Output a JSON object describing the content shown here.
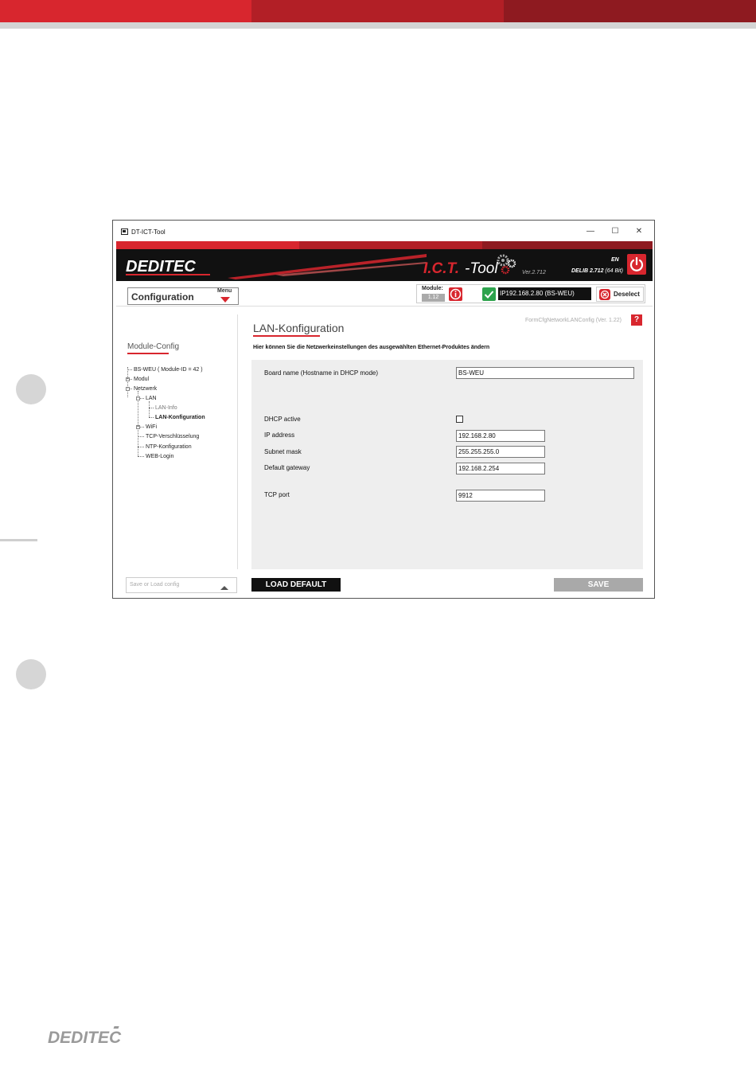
{
  "colors": {
    "accent_red": "#d8262e",
    "dark_red": "#9e1b22",
    "banner_black": "#111111",
    "panel_gray": "#eeeeee",
    "ok_green": "#2da34d"
  },
  "window": {
    "title": "DT-ICT-Tool",
    "minimize": "—",
    "maximize": "☐",
    "close": "✕"
  },
  "banner": {
    "logo_text": "DEDITEC",
    "app_name_ict": "I.C.T.",
    "app_name_tool": "-Tool",
    "version": "Ver.2.712",
    "language": "EN",
    "delib_label": "DELIB 2.712",
    "delib_bits": "(64 Bit)",
    "power_icon": "power-icon",
    "gears_icon": "gears-icon"
  },
  "toolbar": {
    "configuration_label": "Configuration",
    "menu_label": "Menu",
    "module_label": "Module:",
    "module_value": "1.12",
    "ip_value": "IP192.168.2.80 (BS-WEU)",
    "deselect_label": "Deselect"
  },
  "sidebar": {
    "title": "Module-Config",
    "tree": [
      {
        "label": "BS-WEU ( Module-ID = 42 )"
      },
      {
        "label": "Modul"
      },
      {
        "label": "Netzwerk"
      },
      {
        "label": "LAN"
      },
      {
        "label": "LAN-Info"
      },
      {
        "label": "LAN-Konfiguration"
      },
      {
        "label": "WiFi"
      },
      {
        "label": "TCP-Verschlüsselung"
      },
      {
        "label": "NTP-Konfiguration"
      },
      {
        "label": "WEB-Login"
      }
    ],
    "save_load_placeholder": "Save or Load config"
  },
  "main": {
    "title": "LAN-Konfiguration",
    "form_id": "FormCfgNetworkLANConfig (Ver. 1.22)",
    "help": "?",
    "description": "Hier können Sie die Netzwerkeinstellungen des ausgewählten Ethernet-Produktes ändern",
    "fields": {
      "board_name": {
        "label": "Board name (Hostname in DHCP mode)",
        "value": "BS-WEU"
      },
      "dhcp_active": {
        "label": "DHCP active",
        "checked": false
      },
      "ip_address": {
        "label": "IP address",
        "value": "192.168.2.80"
      },
      "subnet_mask": {
        "label": "Subnet mask",
        "value": "255.255.255.0"
      },
      "default_gateway": {
        "label": "Default gateway",
        "value": "192.168.2.254"
      },
      "tcp_port": {
        "label": "TCP port",
        "value": "9912"
      }
    },
    "load_default_label": "LOAD DEFAULT",
    "save_label": "SAVE"
  },
  "footer": {
    "logo_text": "DEDITEC"
  }
}
